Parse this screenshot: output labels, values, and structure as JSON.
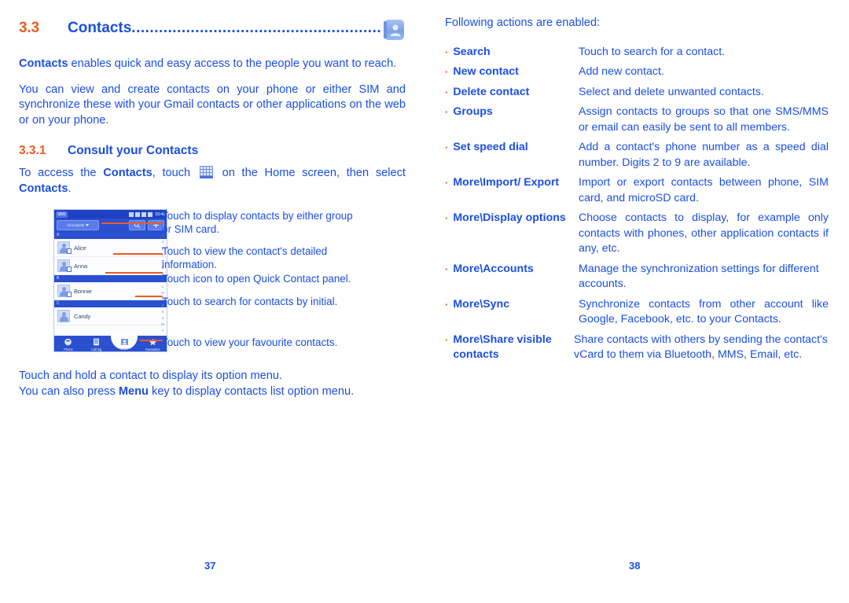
{
  "left_page": {
    "section": {
      "number": "3.3",
      "title": "Contacts",
      "dots": "..................................................................",
      "icon": "contacts-app-icon"
    },
    "intro_paragraph_1_bold": "Contacts",
    "intro_paragraph_1_rest": " enables quick and easy access to the people you want to reach.",
    "intro_paragraph_2": "You can view and create contacts on your phone or either SIM and synchronize these with your Gmail contacts or other applications on the web or on your phone.",
    "subsection": {
      "number": "3.3.1",
      "title": "Consult your Contacts"
    },
    "access_text_1": "To access the ",
    "access_bold_1": "Contacts",
    "access_text_2": ", touch ",
    "access_icon": "app-grid-icon",
    "access_text_3": " on the Home screen, then select ",
    "access_bold_2": "Contacts",
    "access_text_4": ".",
    "phone_mock": {
      "status_bar": {
        "carrier_label": "SIM1",
        "time": "16:49",
        "icons": [
          "vibrate-icon",
          "signal-icon",
          "signal-icon",
          "battery-icon"
        ]
      },
      "action_bar": {
        "spinner_label": "All contacts",
        "spinner_icon": "chevron-down-icon",
        "search_icon": "search-icon",
        "add_icon": "add-contact-icon"
      },
      "sections": [
        {
          "letter": "A",
          "contacts": [
            {
              "name": "Alice",
              "avatar": "contact-avatar",
              "badge": "sim-badge"
            },
            {
              "name": "Anna",
              "avatar": "contact-avatar",
              "badge": "sim-badge"
            }
          ]
        },
        {
          "letter": "B",
          "contacts": [
            {
              "name": "Bonnie",
              "avatar": "contact-avatar",
              "badge": "sim-badge"
            }
          ]
        },
        {
          "letter": "C",
          "contacts": [
            {
              "name": "Candy",
              "avatar": "contact-avatar",
              "badge": ""
            }
          ]
        }
      ],
      "alpha_index": [
        "#",
        "A",
        "B",
        "C",
        "D",
        "E",
        "G",
        "I",
        "L",
        "N",
        "O",
        "R",
        "S",
        "U",
        "W",
        "Y"
      ],
      "tabs": [
        {
          "label": "Phone",
          "icon": "phone-icon",
          "active": false
        },
        {
          "label": "Call log",
          "icon": "call-log-icon",
          "active": false
        },
        {
          "label": "Contacts",
          "icon": "contacts-icon",
          "active": true
        },
        {
          "label": "Favourites",
          "icon": "star-icon",
          "active": false
        }
      ]
    },
    "callouts": [
      "Touch to display contacts by either group or SIM card.",
      "Touch to view the contact's detailed information.",
      "Touch icon to open Quick Contact panel.",
      "Touch to search for contacts by initial.",
      "Touch to view your favourite contacts."
    ],
    "closing_line_1": "Touch and hold a contact to display its option menu.",
    "closing_line_2_a": "You can also press ",
    "closing_line_2_bold": "Menu",
    "closing_line_2_b": " key to display contacts list option menu.",
    "page_number": "37"
  },
  "right_page": {
    "intro": "Following actions are enabled:",
    "actions": [
      {
        "term": "Search",
        "desc": "Touch to search for a contact."
      },
      {
        "term": "New contact",
        "desc": "Add new contact."
      },
      {
        "term": "Delete contact",
        "desc": "Select and delete unwanted contacts."
      },
      {
        "term": "Groups",
        "desc": "Assign contacts to groups so that one SMS/MMS or email can easily be sent to all members."
      },
      {
        "term": "Set speed dial",
        "desc": "Add a contact's phone number as a speed dial number.  Digits 2 to 9 are available."
      },
      {
        "term": "More\\Import/ Export",
        "desc": "Import or export contacts between phone, SIM card, and microSD card."
      },
      {
        "term": "More\\Display options",
        "desc": "Choose contacts to display, for example only contacts with phones, other application contacts if any, etc."
      },
      {
        "term": "More\\Accounts",
        "desc": "Manage the synchronization settings for different accounts."
      },
      {
        "term": "More\\Sync",
        "desc": "Synchronize contacts from other account like Google, Facebook, etc. to your Contacts."
      },
      {
        "term": "More\\Share visible contacts",
        "desc": "Share contacts with others by sending the contact's vCard to them via Bluetooth, MMS, Email, etc."
      }
    ],
    "page_number": "38"
  },
  "colors": {
    "text_blue": "#1b4ee0",
    "accent_orange": "#ef5a22",
    "phone_chrome_blue": "#2a50cf",
    "background": "#ffffff"
  }
}
